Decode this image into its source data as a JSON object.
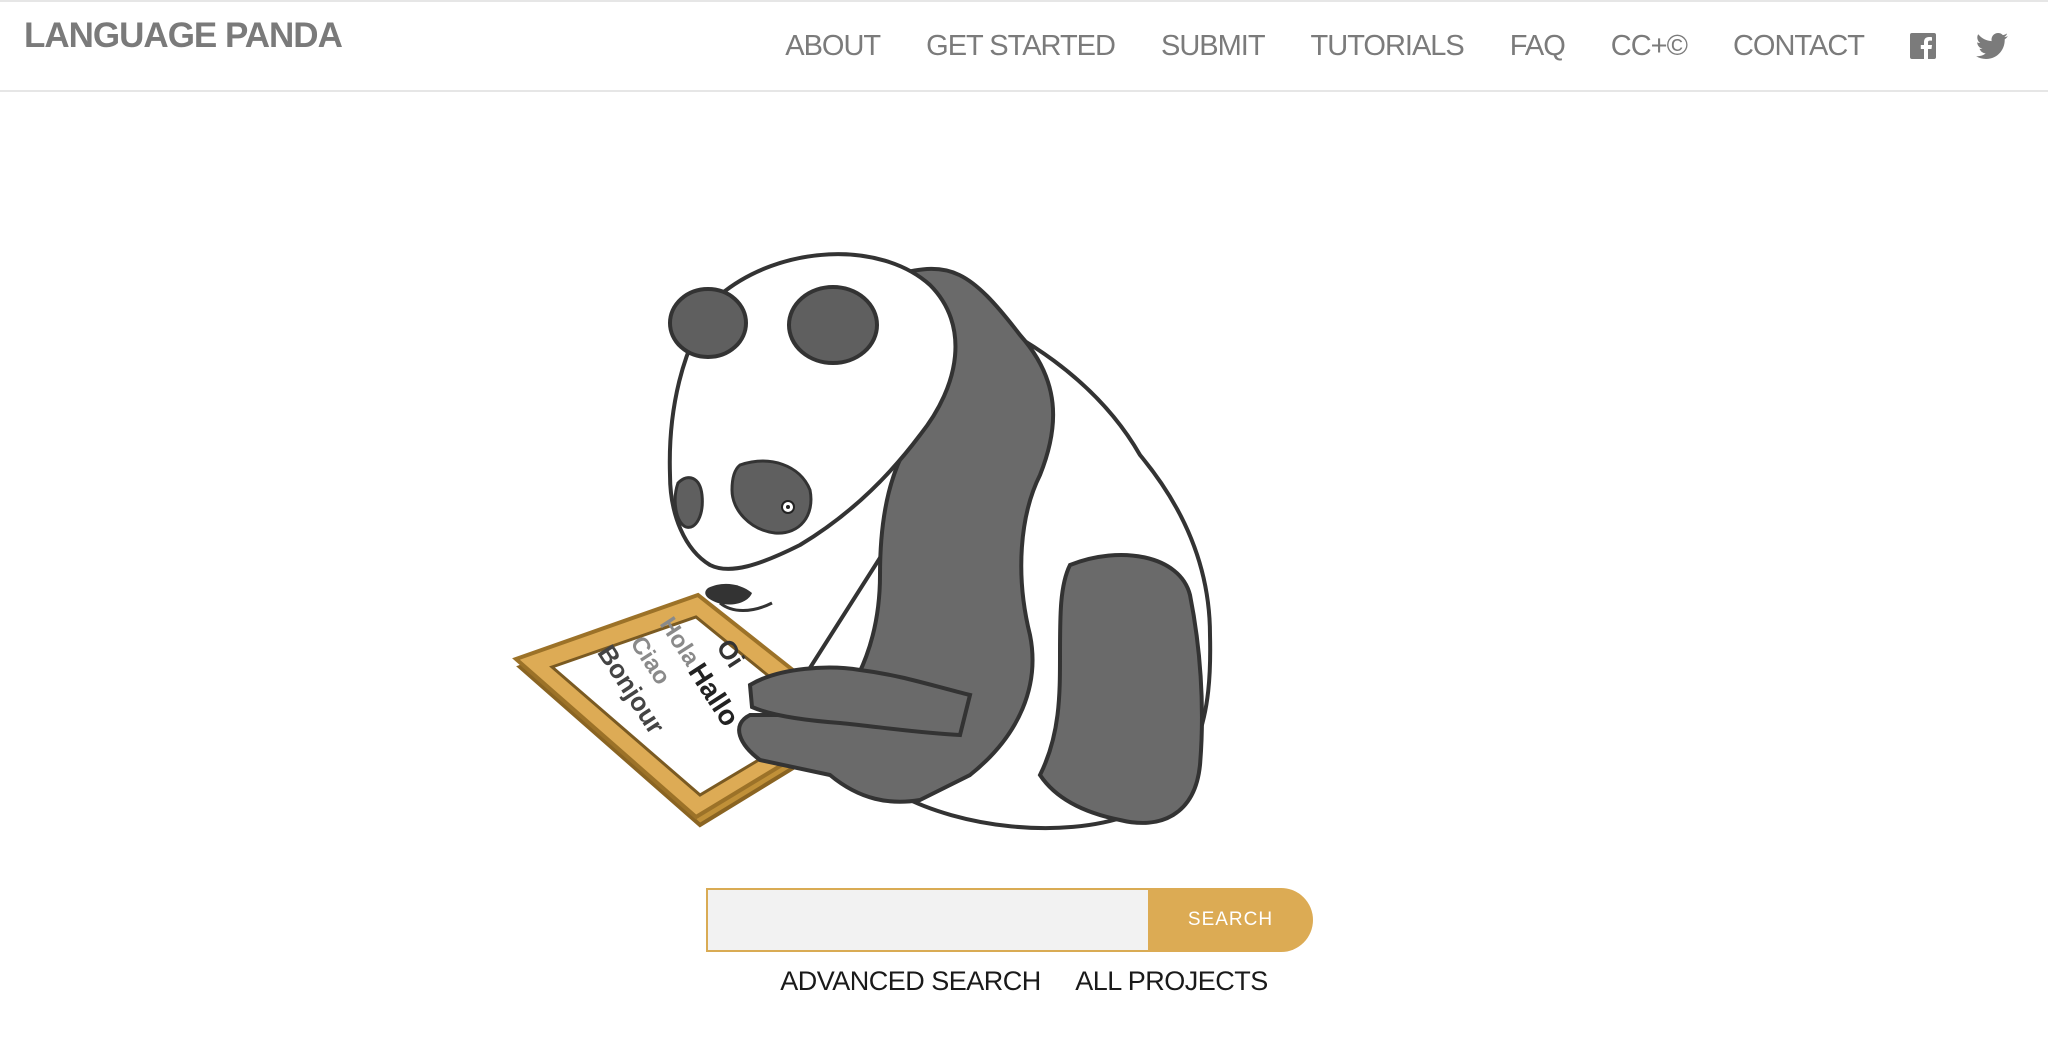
{
  "brand": "LANGUAGE PANDA",
  "nav": {
    "items": [
      "ABOUT",
      "GET STARTED",
      "SUBMIT",
      "TUTORIALS",
      "FAQ",
      "CC+©",
      "CONTACT"
    ],
    "social": [
      "facebook-icon",
      "twitter-icon"
    ]
  },
  "hero": {
    "tablet_words": [
      "Oi",
      "Hola",
      "Hallo",
      "Ciao",
      "Bonjour"
    ]
  },
  "search": {
    "placeholder": "",
    "value": "",
    "button_label": "SEARCH"
  },
  "links": {
    "advanced": "ADVANCED SEARCH",
    "all_projects": "ALL PROJECTS"
  },
  "colors": {
    "accent": "#dcab54",
    "nav_text": "#7b7b7b",
    "input_bg": "#f2f2f2"
  }
}
